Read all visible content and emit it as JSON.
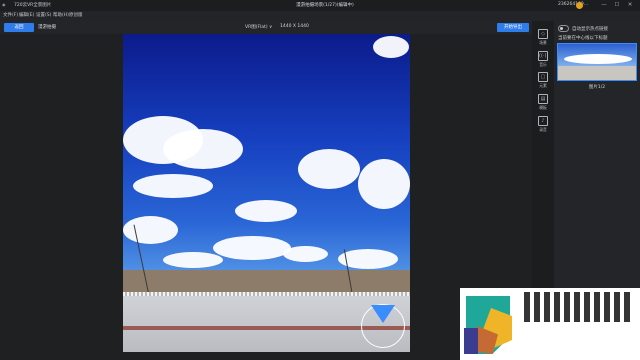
{
  "titlebar": {
    "app_name": "720云VR全景图片",
    "doc_title": "漫游拍摄场景(1/27)(编辑中)",
    "account": "236264109...",
    "minimize": "—",
    "maximize": "☐",
    "close": "✕"
  },
  "menu": [
    {
      "label": "文件(F)"
    },
    {
      "label": "编辑(E)"
    },
    {
      "label": "设置(S)"
    },
    {
      "label": "帮助(H)"
    },
    {
      "label": "原创版"
    }
  ],
  "toolbar": {
    "back_label": "返回",
    "scene_label": "漫游拍摄",
    "view_mode": "VR图(Flat) ∨",
    "resolution": "1440 X 1440",
    "export_label": "开始导出"
  },
  "tools": [
    {
      "icon": "cube-icon",
      "glyph": "◇",
      "label": "场景"
    },
    {
      "icon": "audio-icon",
      "glyph": "((·))",
      "label": "音乐"
    },
    {
      "icon": "layer-icon",
      "glyph": "▢",
      "label": "元素"
    },
    {
      "icon": "book-icon",
      "glyph": "▤",
      "label": "模板"
    },
    {
      "icon": "mic-icon",
      "glyph": "♪",
      "label": "录音"
    }
  ],
  "side_panel": {
    "toggle_label": "自动显示热点链接",
    "hint": "当前要在中心线以下标题",
    "thumb_label": "图片1/2"
  },
  "colors": {
    "accent": "#2f7dea",
    "sky_top": "#0c1b8c",
    "compass_wedge": "#3a8dff"
  }
}
